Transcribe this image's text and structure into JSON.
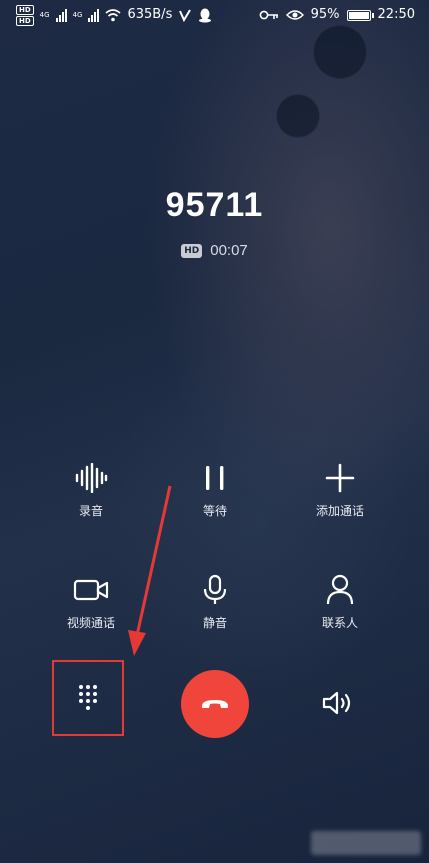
{
  "status_bar": {
    "hd_top": "HD",
    "hd_bottom": "HD",
    "net1": "4G",
    "net2": "4G",
    "speed": "635B/s",
    "battery": "95%",
    "battery_level": 0.95,
    "time": "22:50"
  },
  "call": {
    "number": "95711",
    "hd_badge": "HD",
    "duration": "00:07"
  },
  "actions": {
    "record": "录音",
    "hold": "等待",
    "add_call": "添加通话",
    "video_call": "视频通话",
    "mute": "静音",
    "contacts": "联系人"
  },
  "colors": {
    "end_call": "#f0453b",
    "highlight": "#e53935"
  }
}
